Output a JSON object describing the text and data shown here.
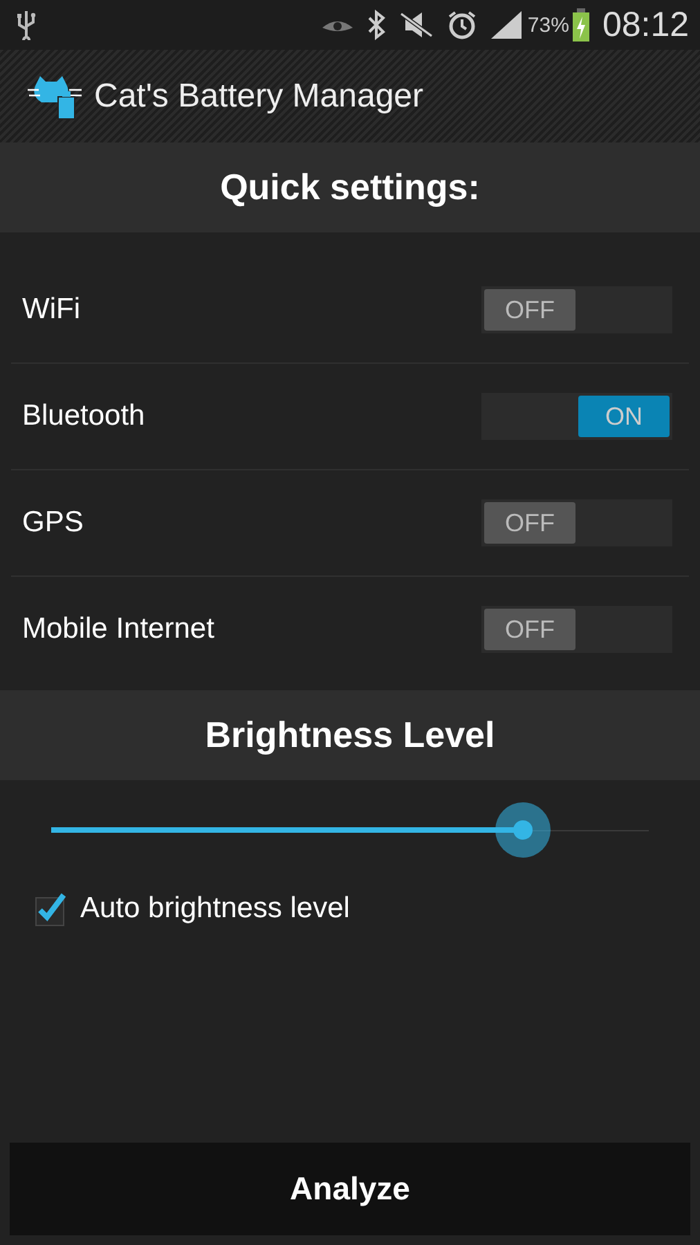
{
  "status_bar": {
    "battery": "73%",
    "time": "08:12"
  },
  "app_bar": {
    "title": "Cat's Battery Manager"
  },
  "quick_settings": {
    "title": "Quick settings:",
    "toggles": [
      {
        "label": "WiFi",
        "on": false,
        "text": "OFF"
      },
      {
        "label": "Bluetooth",
        "on": true,
        "text": "ON"
      },
      {
        "label": "GPS",
        "on": false,
        "text": "OFF"
      },
      {
        "label": "Mobile Internet",
        "on": false,
        "text": "OFF"
      }
    ]
  },
  "brightness": {
    "title": "Brightness Level",
    "slider": {
      "level": 0.79
    },
    "auto": {
      "label": "Auto brightness level",
      "checked": true
    }
  },
  "buttons": [
    "Analyze"
  ]
}
